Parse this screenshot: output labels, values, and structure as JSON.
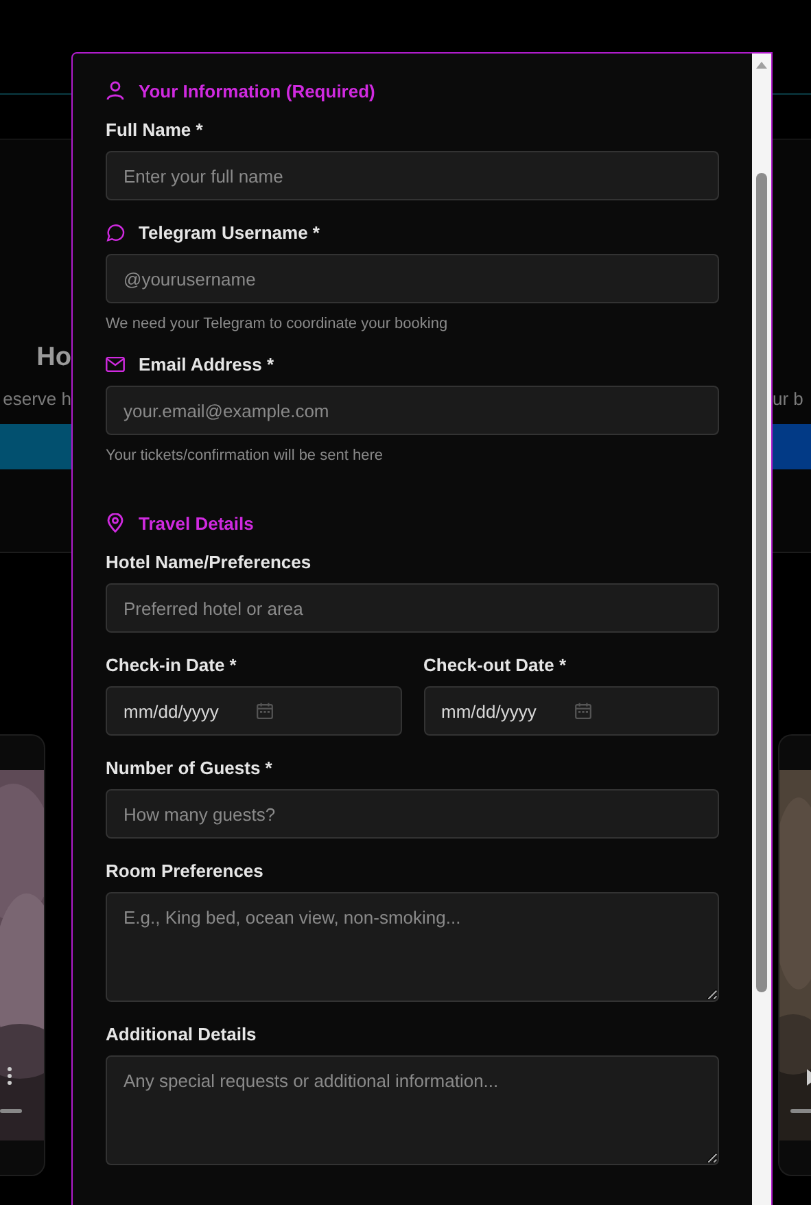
{
  "background": {
    "heading_fragment": "Ho",
    "subtitle_left_fragment": "eserve h",
    "subtitle_right_fragment": "ur b"
  },
  "sections": [
    {
      "title": "Your Information (Required)",
      "fields": [
        {
          "label": "Full Name *",
          "kind": "text",
          "placeholder": "Enter your full name"
        },
        {
          "label": "Telegram Username *",
          "kind": "telegram",
          "placeholder": "@yourusername",
          "help": "We need your Telegram to coordinate your booking"
        },
        {
          "label": "Email Address *",
          "kind": "email",
          "placeholder": "your.email@example.com",
          "help": "Your tickets/confirmation will be sent here"
        }
      ]
    },
    {
      "title": "Travel Details",
      "fields": [
        {
          "label": "Hotel Name/Preferences",
          "kind": "text",
          "placeholder": "Preferred hotel or area"
        },
        {
          "label": "Check-in Date *",
          "kind": "date",
          "placeholder": "mm/dd/yyyy"
        },
        {
          "label": "Check-out Date *",
          "kind": "date",
          "placeholder": "mm/dd/yyyy"
        },
        {
          "label": "Number of Guests *",
          "kind": "number",
          "placeholder": "How many guests?"
        },
        {
          "label": "Room Preferences",
          "kind": "textarea",
          "placeholder": "E.g., King bed, ocean view, non-smoking..."
        },
        {
          "label": "Additional Details",
          "kind": "textarea",
          "placeholder": "Any special requests or additional information..."
        }
      ]
    }
  ]
}
